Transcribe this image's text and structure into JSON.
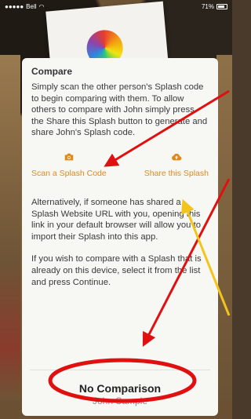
{
  "status_bar": {
    "carrier": "Bell",
    "battery": "71%"
  },
  "dialog": {
    "title": "Compare",
    "intro": "Simply scan the other person's Splash code to begin comparing with them. To allow others to compare with John simply press the Share this Splash button to generate and share John's Splash code.",
    "scan_button": {
      "label": "Scan a Splash Code",
      "icon": "camera-icon"
    },
    "share_button": {
      "label": "Share this Splash",
      "icon": "cloud-upload-icon"
    },
    "alternative": "Alternatively, if someone has shared a Splash Website URL with you, opening this link in your default browser will allow you to import their Splash into this app.",
    "select_hint": "If you wish to compare with a Splash that is already on this device, select it from the list and press Continue.",
    "comparison": {
      "title": "No Comparison",
      "subtitle": "John Sample"
    }
  },
  "colors": {
    "accent": "#e08a1c",
    "annotation_red": "#e01010",
    "annotation_yellow": "#f3c51c"
  }
}
